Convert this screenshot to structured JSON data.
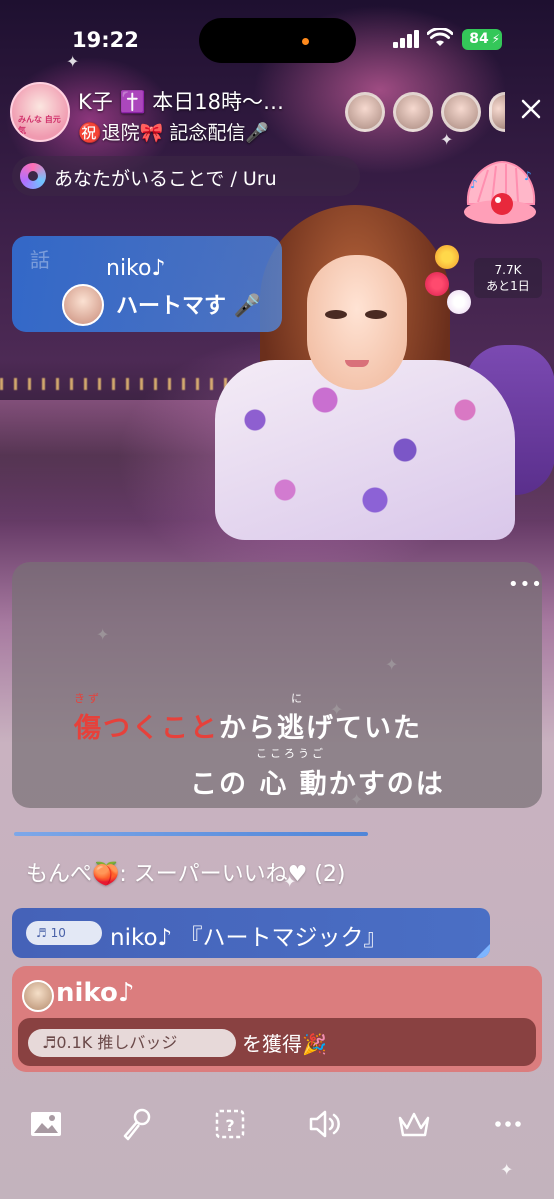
{
  "status_bar": {
    "time": "19:22",
    "battery": "84"
  },
  "header": {
    "host_name": "K子 ✝️ 本日18時〜…",
    "host_subtitle": "㊗️退院🎀 記念配信🎤",
    "avatar_text": "みんな 自元気",
    "viewer_count": 4
  },
  "song": {
    "label": "あなたがいることで / Uru"
  },
  "gift_card": {
    "user": "niko♪",
    "message": "ハートマ",
    "watermark": "話",
    "extra": "す"
  },
  "counter": {
    "value": "7.7K",
    "remaining": "あと1日"
  },
  "lyrics": {
    "line1_sung": "傷つくこと",
    "line1_rest": "から逃げていた",
    "line1_ruby_sung": "きず",
    "line1_ruby_rest": "に",
    "line2": "この 心 動かすのは",
    "line2_ruby": "こころうご"
  },
  "comments": {
    "like_comment": "もんぺ🍑: スーパーいいね♥ (2)",
    "request_tag": "♬ 10",
    "request_text": "niko♪ 『ハートマジック』",
    "badge_user": "niko♪",
    "badge_pill": "♬0.1K 推しバッジ",
    "badge_text": "を獲得🎉"
  },
  "toolbar": {
    "items": [
      "image-icon",
      "microphone-icon",
      "question-icon",
      "speaker-icon",
      "crown-icon",
      "more-icon"
    ]
  },
  "colors": {
    "accent_red": "#e6413b",
    "request_blue": "#4562b8",
    "badge_red": "#dc7878",
    "battery_green": "#34c759"
  }
}
